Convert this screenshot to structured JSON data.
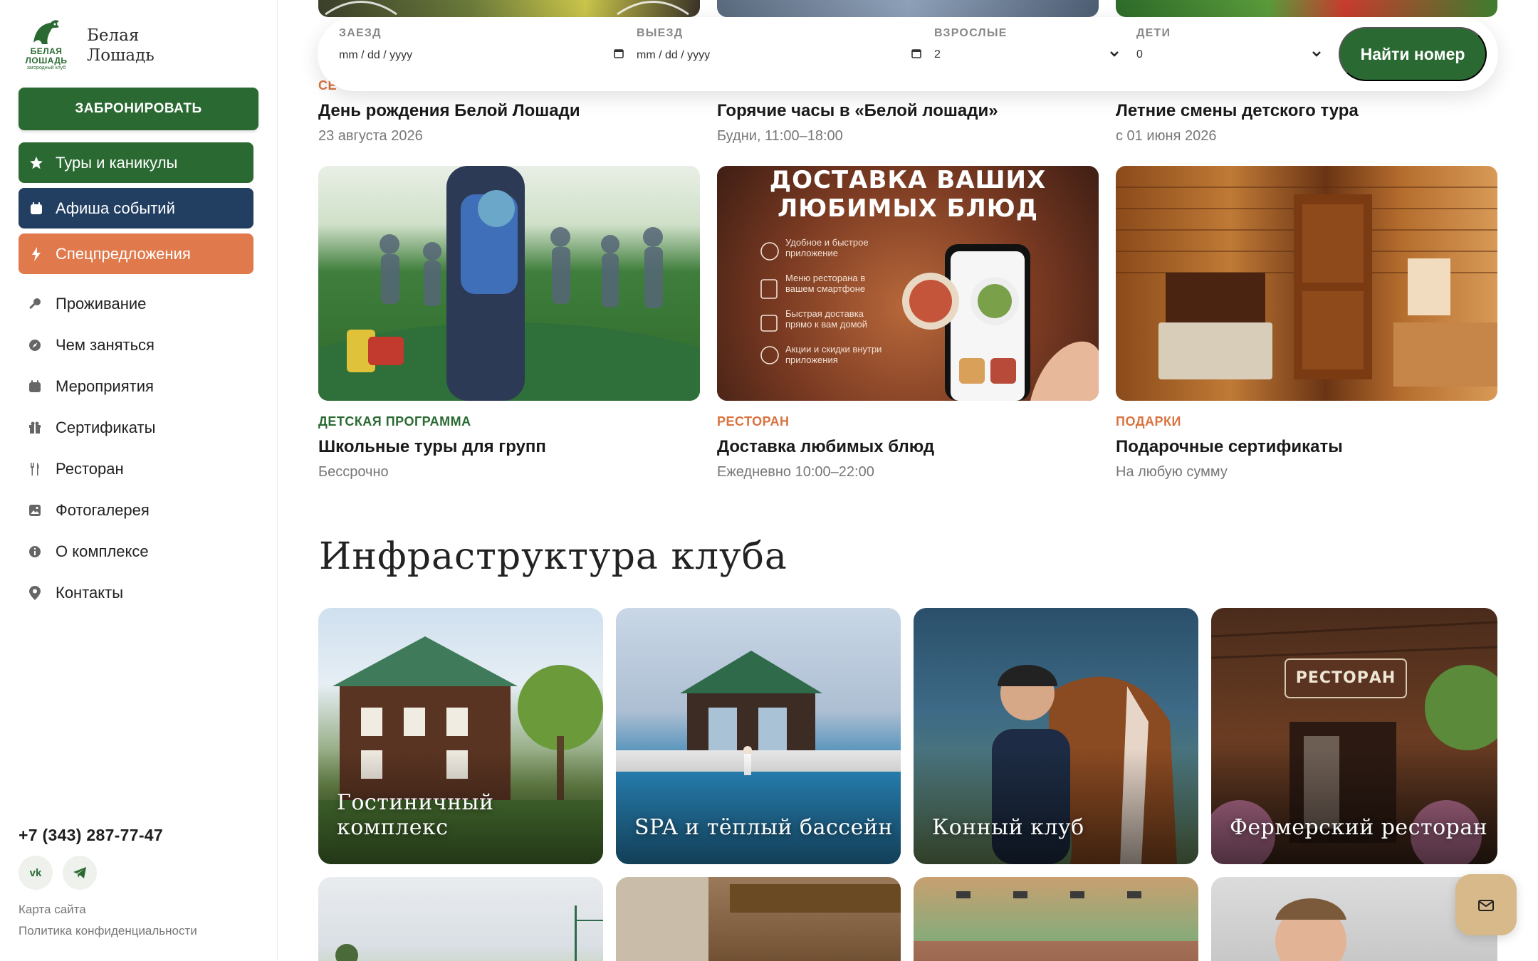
{
  "brand": {
    "name_line1": "Белая",
    "name_line2": "Лошадь",
    "mark_line1": "БЕЛАЯ",
    "mark_line2": "ЛОШАДЬ",
    "mark_tagline": "загородный клуб"
  },
  "sidebar": {
    "book_button": "ЗАБРОНИРОВАТЬ",
    "pills": [
      {
        "label": "Туры и каникулы",
        "icon": "star-icon"
      },
      {
        "label": "Афиша событий",
        "icon": "calendar-icon"
      },
      {
        "label": "Спецпредложения",
        "icon": "lightning-icon"
      }
    ],
    "items": [
      {
        "label": "Проживание",
        "icon": "key-icon"
      },
      {
        "label": "Чем заняться",
        "icon": "compass-icon"
      },
      {
        "label": "Мероприятия",
        "icon": "calendar-icon"
      },
      {
        "label": "Сертификаты",
        "icon": "gift-icon"
      },
      {
        "label": "Ресторан",
        "icon": "fork-knife-icon"
      },
      {
        "label": "Фотогалерея",
        "icon": "photo-icon"
      },
      {
        "label": "О комплексе",
        "icon": "info-icon"
      },
      {
        "label": "Контакты",
        "icon": "location-pin-icon"
      }
    ],
    "phone": "+7 (343) 287-77-47",
    "social_vk": "vk",
    "footer_links": [
      "Карта сайта",
      "Политика конфиденциальности"
    ]
  },
  "booking": {
    "checkin_label": "ЗАЕЗД",
    "checkin_value": "mm / dd / yyyy",
    "checkout_label": "ВЫЕЗД",
    "checkout_value": "mm / dd / yyyy",
    "adults_label": "ВЗРОСЛЫЕ",
    "adults_value": "2",
    "children_label": "ДЕТИ",
    "children_value": "0",
    "find_button": "Найти номер"
  },
  "cards_top": [
    {
      "category": "СЕ",
      "title": "День рождения Белой Лошади",
      "subtitle": "23 августа 2026"
    },
    {
      "category": "",
      "title": "Горячие часы в «Белой лошади»",
      "subtitle": "Будни, 11:00–18:00"
    },
    {
      "category": "",
      "title": "Летние смены детского тура",
      "subtitle": "с 01 июня 2026"
    }
  ],
  "cards_mid": [
    {
      "category": "ДЕТСКАЯ ПРОГРАММА",
      "title": "Школьные туры для групп",
      "subtitle": "Бессрочно",
      "color": "#2a6a32"
    },
    {
      "category": "РЕСТОРАН",
      "title": "Доставка любимых блюд",
      "subtitle": "Ежедневно 10:00–22:00",
      "color": "#d9733f"
    },
    {
      "category": "ПОДАРКИ",
      "title": "Подарочные сертификаты",
      "subtitle": "На любую сумму",
      "color": "#d9733f"
    }
  ],
  "delivery_ad": {
    "headline1": "ДОСТАВКА ВАШИХ",
    "headline2": "ЛЮБИМЫХ БЛЮД",
    "features": [
      "Удобное и быстрое приложение",
      "Меню ресторана в вашем смартфоне",
      "Быстрая доставка прямо к вам домой",
      "Акции и скидки внутри приложения"
    ]
  },
  "infrastructure": {
    "title": "Инфраструктура клуба",
    "items": [
      {
        "label": "Гостиничный комплекс"
      },
      {
        "label": "SPA и тёплый бассейн"
      },
      {
        "label": "Конный клуб"
      },
      {
        "label": "Фермерский ресторан",
        "sign": "РЕСТОРАН"
      }
    ]
  },
  "fab_icon": "mail-icon"
}
